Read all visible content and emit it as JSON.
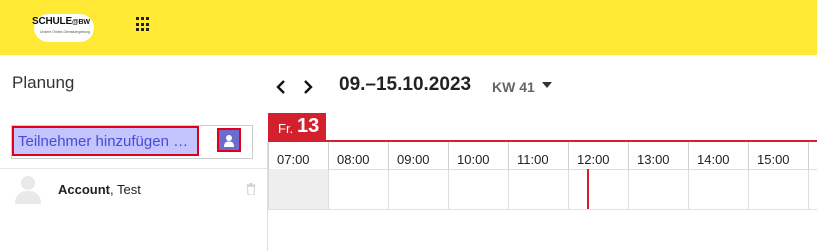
{
  "header": {
    "logo": {
      "main": "SCHULE",
      "suffix": "@BW",
      "tagline": "Unsere Online-Dienstumgebung"
    },
    "apps_icon": "apps-grid-icon"
  },
  "sidebar": {
    "title": "Planung",
    "participant_input": {
      "placeholder": "Teilnehmer hinzufügen …",
      "value": ""
    },
    "add_user_icon": "add-user-icon",
    "members": [
      {
        "last_name": "Account",
        "first_name": "Test",
        "avatar_icon": "avatar-icon",
        "delete_icon": "trash-icon"
      }
    ]
  },
  "toolbar": {
    "prev_icon": "chevron-left-icon",
    "next_icon": "chevron-right-icon",
    "week_range": "09.–15.10.2023",
    "week_label": "KW 41",
    "week_dropdown_icon": "caret-down-icon"
  },
  "day": {
    "abbr": "Fr.",
    "number": "13"
  },
  "hours": [
    "07:00",
    "08:00",
    "09:00",
    "10:00",
    "11:00",
    "12:00",
    "13:00",
    "14:00",
    "15:00"
  ],
  "colors": {
    "header_bg": "#ffe935",
    "accent_red": "#d2202d",
    "selection_fill": "#c4c4ff",
    "selection_text": "#4a4ad6",
    "button_fill": "#6c6ccf"
  }
}
